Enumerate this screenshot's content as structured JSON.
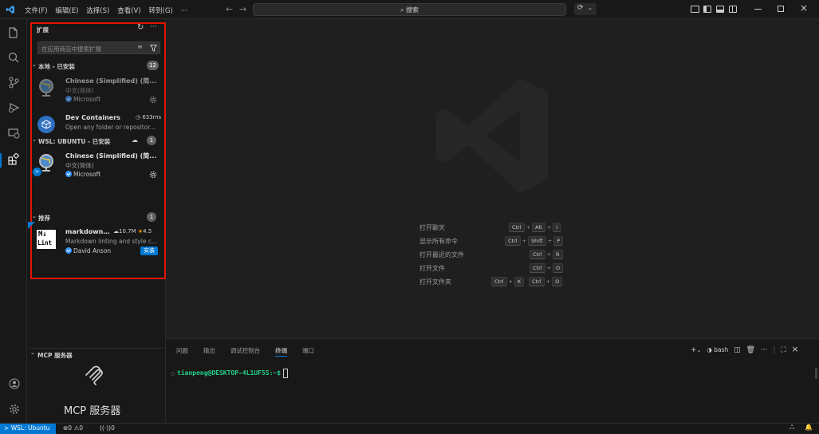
{
  "titlebar": {
    "menus": [
      "文件(F)",
      "编辑(E)",
      "选择(S)",
      "查看(V)",
      "转到(G)",
      "···"
    ],
    "search_placeholder": "搜索",
    "window_controls": [
      "minimize-icon",
      "restore-icon",
      "close-icon"
    ]
  },
  "activity_bar": {
    "items": [
      "explorer-icon",
      "search-icon",
      "source-control-icon",
      "run-debug-icon",
      "remote-explorer-icon",
      "extensions-icon"
    ],
    "bottom_items": [
      "account-icon",
      "settings-gear-icon"
    ]
  },
  "extensions": {
    "title": "扩展",
    "search_placeholder": "在应用商店中搜索扩展",
    "sections": {
      "local": {
        "label": "本地 - 已安装",
        "count": "12"
      },
      "wsl": {
        "label": "WSL: UBUNTU - 已安装",
        "count": "1"
      },
      "recommended": {
        "label": "推荐",
        "count": "1"
      }
    },
    "items": [
      {
        "name": "Chinese (Simplified) (简...",
        "desc": "中文(简体)",
        "publisher": "Microsoft"
      },
      {
        "name": "Dev Containers",
        "desc": "Open any folder or repositor...",
        "time": "633ms"
      },
      {
        "name": "Chinese (Simplified) (简...",
        "desc": "中文(简体)",
        "publisher": "Microsoft"
      },
      {
        "name": "markdownl...",
        "desc": "Markdown linting and style c...",
        "publisher": "David Anson",
        "downloads": "10.7M",
        "rating": "4.5",
        "install_label": "安装"
      }
    ]
  },
  "mcp": {
    "header": "MCP 服务器",
    "title": "MCP 服务器"
  },
  "welcome_hints": [
    {
      "label": "打开聊天",
      "keys": [
        [
          "Ctrl",
          "Alt",
          "I"
        ]
      ]
    },
    {
      "label": "显示所有命令",
      "keys": [
        [
          "Ctrl",
          "Shift",
          "P"
        ]
      ]
    },
    {
      "label": "打开最近的文件",
      "keys": [
        [
          "Ctrl",
          "R"
        ]
      ]
    },
    {
      "label": "打开文件",
      "keys": [
        [
          "Ctrl",
          "O"
        ]
      ]
    },
    {
      "label": "打开文件夹",
      "keys": [
        [
          "Ctrl",
          "K"
        ],
        [
          "Ctrl",
          "O"
        ]
      ]
    }
  ],
  "panel": {
    "tabs": [
      "问题",
      "输出",
      "调试控制台",
      "终端",
      "端口"
    ],
    "active_tab": "终端",
    "shell": "bash",
    "prompt": "tianpeng@DESKTOP-4L1UF5S:~$ "
  },
  "statusbar": {
    "remote": "WSL: Ubuntu",
    "errors": "0",
    "warnings": "0",
    "ports": "0"
  },
  "colors": {
    "accent": "#0078d4",
    "highlight_border": "#e51400",
    "badge_bg": "#616161"
  }
}
